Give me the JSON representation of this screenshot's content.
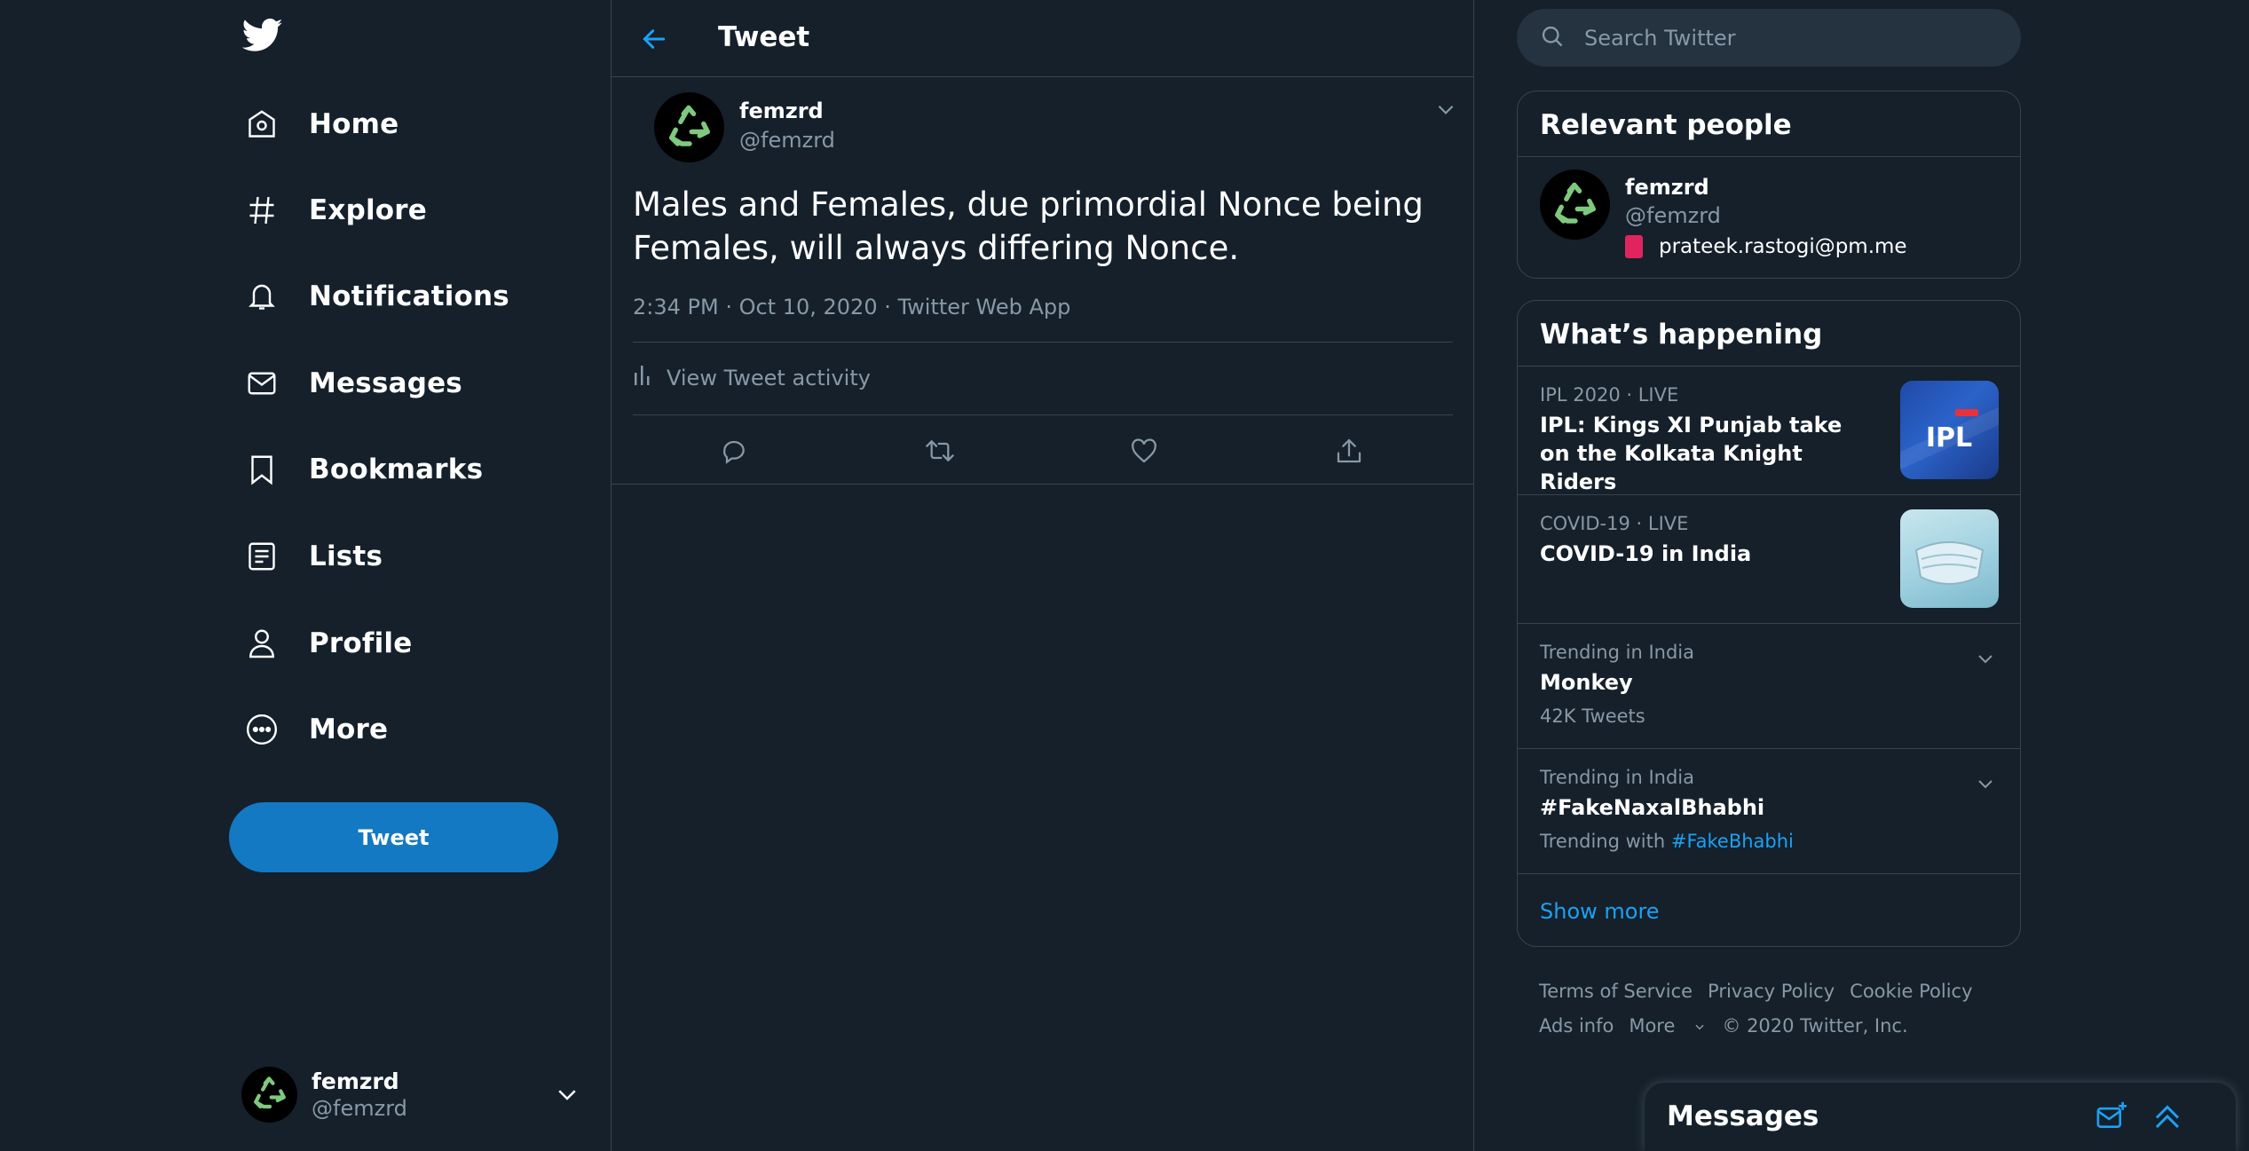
{
  "nav": {
    "items": [
      {
        "label": "Home",
        "icon": "home-icon"
      },
      {
        "label": "Explore",
        "icon": "hashtag-icon"
      },
      {
        "label": "Notifications",
        "icon": "bell-icon"
      },
      {
        "label": "Messages",
        "icon": "envelope-icon"
      },
      {
        "label": "Bookmarks",
        "icon": "bookmark-icon"
      },
      {
        "label": "Lists",
        "icon": "list-icon"
      },
      {
        "label": "Profile",
        "icon": "person-icon"
      },
      {
        "label": "More",
        "icon": "more-circle-icon"
      }
    ],
    "tweet_button": "Tweet",
    "account": {
      "name": "femzrd",
      "handle": "@femzrd"
    }
  },
  "header": {
    "title": "Tweet"
  },
  "tweet": {
    "author_name": "femzrd",
    "author_handle": "@femzrd",
    "text": "Males and Females, due primordial Nonce being Females, will always differing Nonce.",
    "time": "2:34 PM · Oct 10, 2020",
    "source": "Twitter Web App",
    "activity_label": "View Tweet activity"
  },
  "search": {
    "placeholder": "Search Twitter"
  },
  "relevant_people": {
    "title": "Relevant people",
    "name": "femzrd",
    "handle": "@femzrd",
    "bio": "prateek.rastogi@pm.me"
  },
  "happening": {
    "title": "What’s happening",
    "trends": [
      {
        "context": "IPL 2020 · LIVE",
        "title": "IPL: Kings XI Punjab take on the Kolkata Knight Riders"
      },
      {
        "context": "COVID-19 · LIVE",
        "title": "COVID-19 in India"
      },
      {
        "context": "Trending in India",
        "title": "Monkey",
        "sub": "42K Tweets"
      },
      {
        "context": "Trending in India",
        "title": "#FakeNaxalBhabhi",
        "sub_prefix": "Trending with",
        "sub_tag": "#FakeBhabhi"
      }
    ],
    "show_more": "Show more",
    "ipl_logo_text": "IPL"
  },
  "footer": {
    "links": [
      "Terms of Service",
      "Privacy Policy",
      "Cookie Policy",
      "Ads info",
      "More"
    ],
    "copyright": "© 2020 Twitter, Inc."
  },
  "messages_dock": {
    "title": "Messages"
  },
  "colors": {
    "accent": "#1da1f2",
    "button": "#1379c2",
    "background": "#15202b",
    "border": "#38444d",
    "muted": "#8899a6",
    "recycle_green": "#7fc97f"
  }
}
